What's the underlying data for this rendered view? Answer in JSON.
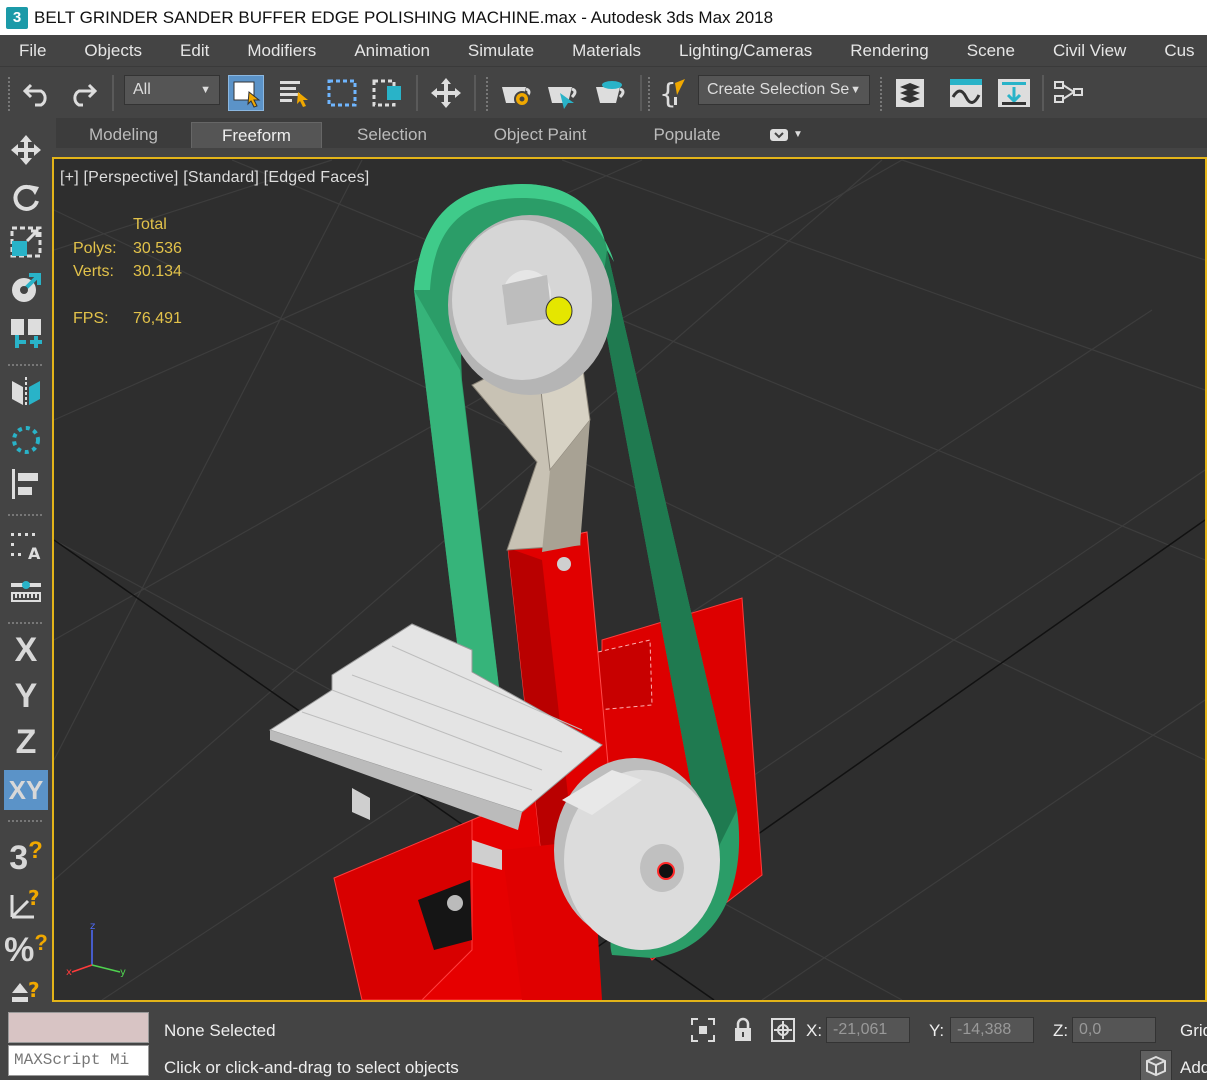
{
  "window": {
    "app_icon": "3",
    "title": "BELT GRINDER SANDER BUFFER EDGE POLISHING MACHINE.max - Autodesk 3ds Max 2018"
  },
  "menu": [
    "File",
    "Objects",
    "Edit",
    "Modifiers",
    "Animation",
    "Simulate",
    "Materials",
    "Lighting/Cameras",
    "Rendering",
    "Scene",
    "Civil View",
    "Cus"
  ],
  "toolbar": {
    "filter_value": "All",
    "selection_set_value": "Create Selection Se",
    "icons": [
      "undo-icon",
      "redo-icon",
      "select-object-icon",
      "select-by-name-icon",
      "rectangular-selection-icon",
      "window-crossing-icon",
      "select-and-move-icon",
      "render-setup-icon",
      "render-frame-icon",
      "render-production-icon",
      "named-selection-icon",
      "layer-explorer-icon",
      "curve-editor-icon",
      "align-icon",
      "schematic-view-icon"
    ]
  },
  "ribbon": {
    "tabs": [
      "Modeling",
      "Freeform",
      "Selection",
      "Object Paint",
      "Populate"
    ],
    "active": "Freeform"
  },
  "left_toolbar": {
    "icons": [
      "move-icon",
      "rotate-icon",
      "scale-icon",
      "place-icon",
      "snap-icon",
      "mirror-icon",
      "array-icon",
      "align-icon",
      "spacing-icon",
      "measure-icon"
    ],
    "axis_labels": [
      "X",
      "Y",
      "Z",
      "XY"
    ],
    "snap_labels": [
      "3",
      "%"
    ]
  },
  "viewport": {
    "label": "[+] [Perspective] [Standard] [Edged Faces]",
    "stats": {
      "header": "Total",
      "polys_label": "Polys:",
      "polys_value": "30.536",
      "verts_label": "Verts:",
      "verts_value": "30.134",
      "fps_label": "FPS:",
      "fps_value": "76,491"
    },
    "axis_gizmo": {
      "x": "x",
      "y": "y",
      "z": "z"
    }
  },
  "status": {
    "listener_input": "MAXScript Mi",
    "selection": "None Selected",
    "prompt": "Click or click-and-drag to select objects",
    "x_label": "X:",
    "x_value": "-21,061",
    "y_label": "Y:",
    "y_value": "-14,388",
    "z_label": "Z:",
    "z_value": "0,0",
    "grid_label": "Grid",
    "add_label": "Add"
  },
  "colors": {
    "viewport_border": "#e3b419",
    "stats_text": "#e2c24a",
    "belt": "#2fb37a",
    "frame": "#e00000",
    "pulley": "#d0d0d0"
  }
}
